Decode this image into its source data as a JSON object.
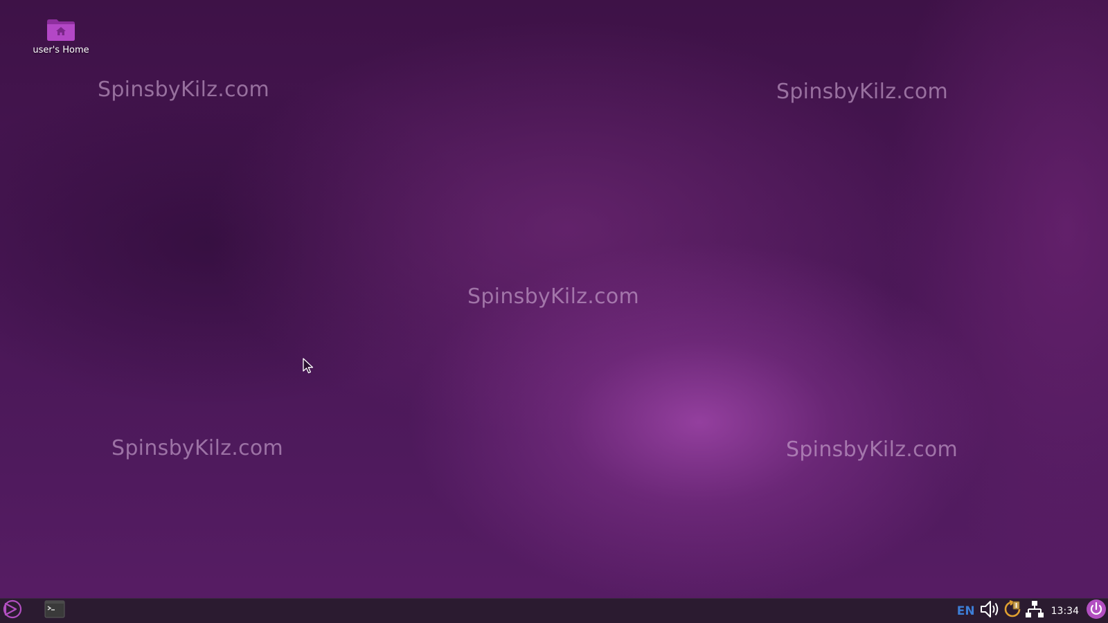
{
  "desktop": {
    "icons": [
      {
        "label": "user's Home",
        "icon": "home-folder-icon"
      }
    ],
    "watermarks": [
      "SpinsbyKilz.com",
      "SpinsbyKilz.com",
      "SpinsbyKilz.com",
      "SpinsbyKilz.com",
      "SpinsbyKilz.com"
    ]
  },
  "taskbar": {
    "start_icon": "start-menu-icon",
    "apps": [
      {
        "icon": "terminal-icon"
      }
    ],
    "tray": {
      "language": "EN",
      "volume_icon": "volume-icon",
      "updates_icon": "updates-icon",
      "network_icon": "network-icon",
      "clock": "13:34",
      "power_icon": "power-icon"
    }
  },
  "colors": {
    "taskbar_bg": "#2b1b30",
    "accent": "#b24fc1",
    "language": "#3d7ed6"
  }
}
